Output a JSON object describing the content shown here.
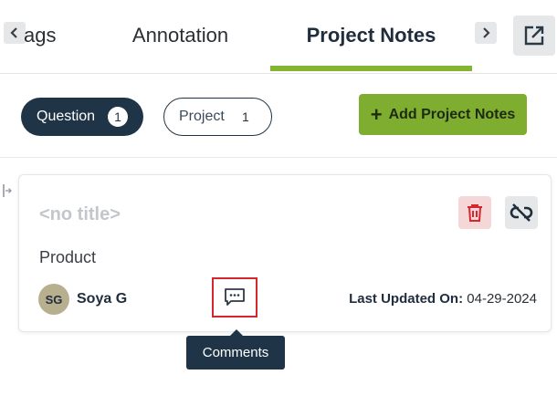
{
  "tabs": [
    {
      "label": "ags"
    },
    {
      "label": "Annotation"
    },
    {
      "label": "Project Notes",
      "active": true
    }
  ],
  "icons": {
    "scroll_left": "chevron-left-icon",
    "scroll_right": "chevron-right-icon",
    "popout": "external-link-icon",
    "delete": "trash-icon",
    "unlink": "unlink-icon",
    "comments": "comment-icon",
    "resize": "resize-handle-icon"
  },
  "filters": {
    "question": {
      "label": "Question",
      "count": "1"
    },
    "project": {
      "label": "Project",
      "count": "1"
    }
  },
  "add_button": {
    "plus": "+",
    "label": "Add Project Notes"
  },
  "note": {
    "title": "<no title>",
    "body": "Product",
    "author_initials": "SG",
    "author_name": "Soya G",
    "updated_label": "Last Updated On:",
    "updated_value": "04-29-2024"
  },
  "tooltip": {
    "label": "Comments"
  },
  "colors": {
    "accent_green": "#83b532",
    "navy": "#1f3547",
    "delete_bg": "#f6d7d7",
    "delete_icon": "#d6262e",
    "highlight_red": "#d6262e"
  }
}
